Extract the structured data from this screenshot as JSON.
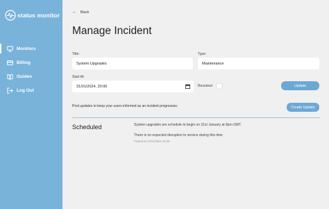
{
  "brand": {
    "name": "status monitor"
  },
  "nav": {
    "items": [
      {
        "label": "Monitors",
        "icon": "monitor-icon",
        "active": true
      },
      {
        "label": "Billing",
        "icon": "billing-icon",
        "active": false
      },
      {
        "label": "Guides",
        "icon": "book-icon",
        "active": false
      },
      {
        "label": "Log Out",
        "icon": "logout-icon",
        "active": false
      }
    ]
  },
  "page": {
    "back_label": "Back",
    "title": "Manage Incident"
  },
  "form": {
    "title_label": "Title:",
    "title_value": "System Upgrades",
    "type_label": "Type:",
    "type_value": "Maintenance",
    "start_label": "Start At:",
    "start_value": "31/01/2024, 20:00",
    "resolved_label": "Resolved",
    "update_button": "Update"
  },
  "updates": {
    "info_text": "Post updates to keep your users informed as an incident progresses.",
    "create_button": "Create Update",
    "status": "Scheduled",
    "message_line1": "System upgrades are schedule to begin on 31st January at 8pm GMT.",
    "message_line2": "There is no expected disruption to service during this time",
    "posted": "Posted at 27/01/2024 22:38"
  },
  "colors": {
    "sidebar": "#79b3da",
    "accent": "#6ca8d4",
    "background": "#f0f0f0"
  }
}
